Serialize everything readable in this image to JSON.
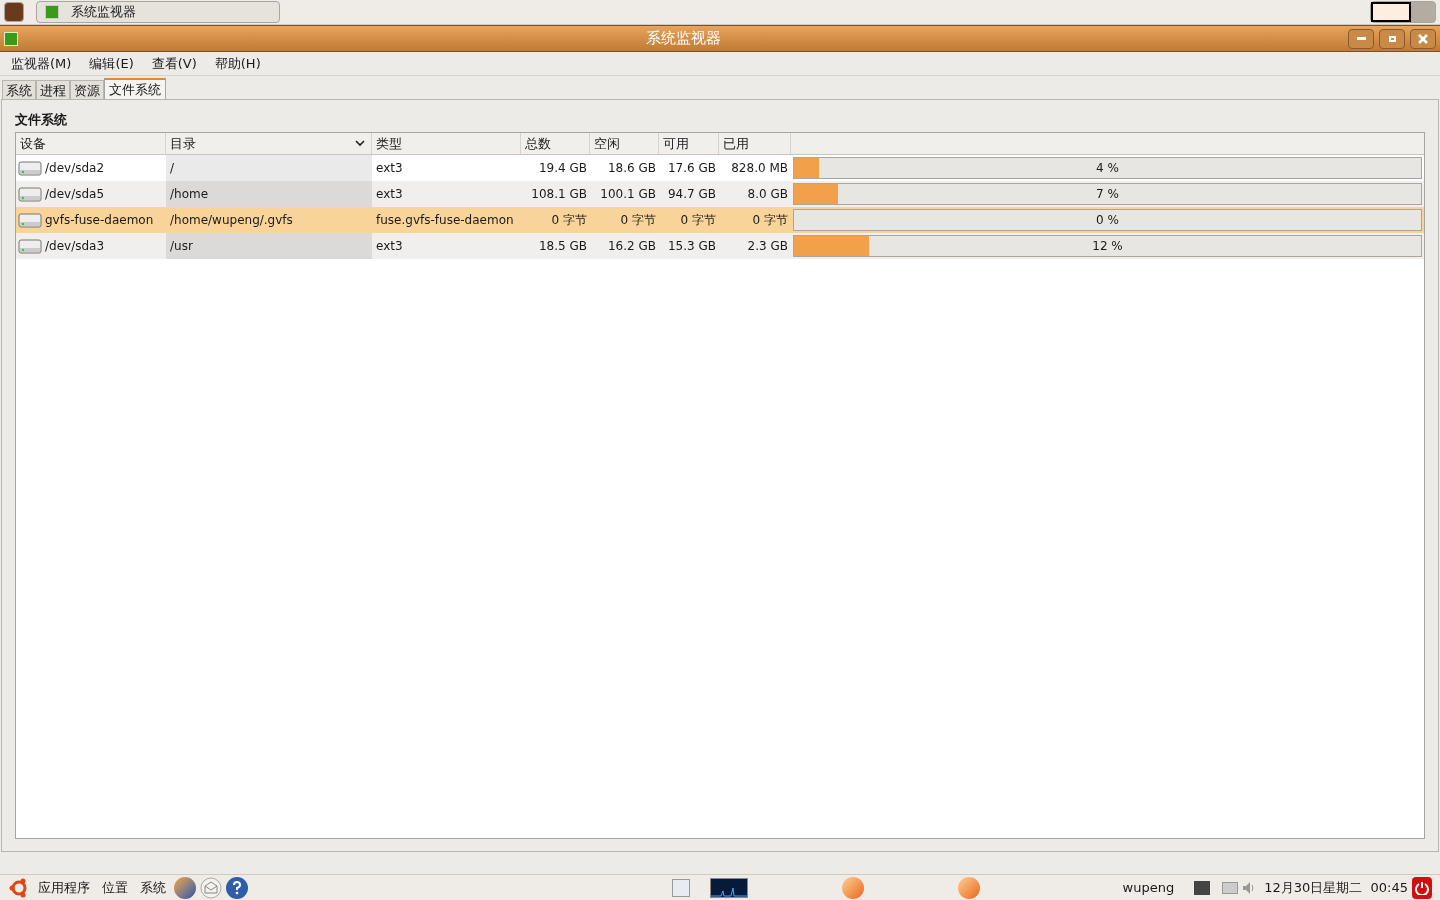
{
  "top_panel": {
    "window_buttons": [
      {
        "title": "系统监视器",
        "selected": false
      }
    ]
  },
  "window": {
    "title": "系统监视器"
  },
  "menu": [
    "监视器(M)",
    "编辑(E)",
    "查看(V)",
    "帮助(H)"
  ],
  "tabs": [
    {
      "label": "系统",
      "selected": false
    },
    {
      "label": "进程",
      "selected": false
    },
    {
      "label": "资源",
      "selected": false
    },
    {
      "label": "文件系统",
      "selected": true
    }
  ],
  "section_title": "文件系统",
  "table": {
    "columns": [
      "设备",
      "目录",
      "类型",
      "总数",
      "空闲",
      "可用",
      "已用"
    ],
    "rows": [
      {
        "device": "/dev/sda2",
        "directory": "/",
        "type": "ext3",
        "total": "19.4 GB",
        "free": "18.6 GB",
        "available": "17.6 GB",
        "used": "828.0 MB",
        "level": 0.04,
        "percent": "4 %",
        "selected": false
      },
      {
        "device": "/dev/sda5",
        "directory": "/home",
        "type": "ext3",
        "total": "108.1 GB",
        "free": "100.1 GB",
        "available": "94.7 GB",
        "used": "8.0 GB",
        "level": 0.07,
        "percent": "7 %",
        "selected": false
      },
      {
        "device": "gvfs-fuse-daemon",
        "directory": "/home/wupeng/.gvfs",
        "type": "fuse.gvfs-fuse-daemon",
        "total": "0 字节",
        "free": "0 字节",
        "available": "0 字节",
        "used": "0 字节",
        "level": 0,
        "percent": "0 %",
        "selected": true
      },
      {
        "device": "/dev/sda3",
        "directory": "/usr",
        "type": "ext3",
        "total": "18.5 GB",
        "free": "16.2 GB",
        "available": "15.3 GB",
        "used": "2.3 GB",
        "level": 0.12,
        "percent": "12 %",
        "selected": false
      }
    ]
  },
  "bottom_panel": {
    "menus": [
      "应用程序",
      "位置",
      "系统"
    ],
    "user": "wupeng",
    "clock": "12月30日星期二  00:45"
  }
}
